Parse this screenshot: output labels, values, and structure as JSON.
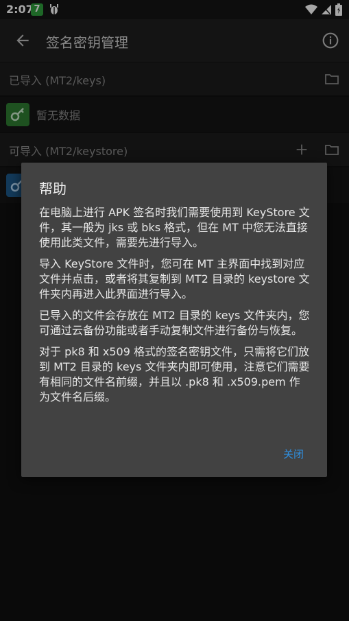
{
  "status_bar": {
    "time": "2:07",
    "notif_badge": "7"
  },
  "app_bar": {
    "title": "签名密钥管理"
  },
  "imported": {
    "label": "已导入 (MT2/keys)",
    "empty_text": "暂无数据"
  },
  "importable": {
    "label": "可导入 (MT2/keystore)"
  },
  "dialog": {
    "title": "帮助",
    "paragraphs": [
      "在电脑上进行 APK 签名时我们需要使用到 KeyStore 文件，其一般为 jks 或 bks 格式，但在 MT 中您无法直接使用此类文件，需要先进行导入。",
      "导入 KeyStore 文件时，您可在 MT 主界面中找到对应文件并点击，或者将其复制到 MT2 目录的 keystore 文件夹内再进入此界面进行导入。",
      "已导入的文件会存放在 MT2 目录的 keys 文件夹内，您可通过云备份功能或者手动复制文件进行备份与恢复。",
      "对于 pk8 和 x509 格式的签名密钥文件，只需将它们放到 MT2 目录的 keys 文件夹内即可使用，注意它们需要有相同的文件名前缀，并且以 .pk8 和 .x509.pem 作为文件名后缀。"
    ],
    "close_label": "关闭"
  },
  "colors": {
    "accent": "#2f8fe0",
    "key_green": "#2e7d32",
    "key_blue": "#1e5a8a"
  },
  "icons": [
    "back-arrow-icon",
    "info-icon",
    "folder-icon",
    "add-icon",
    "key-icon",
    "wifi-icon",
    "signal-icon",
    "battery-icon",
    "bug-icon"
  ]
}
